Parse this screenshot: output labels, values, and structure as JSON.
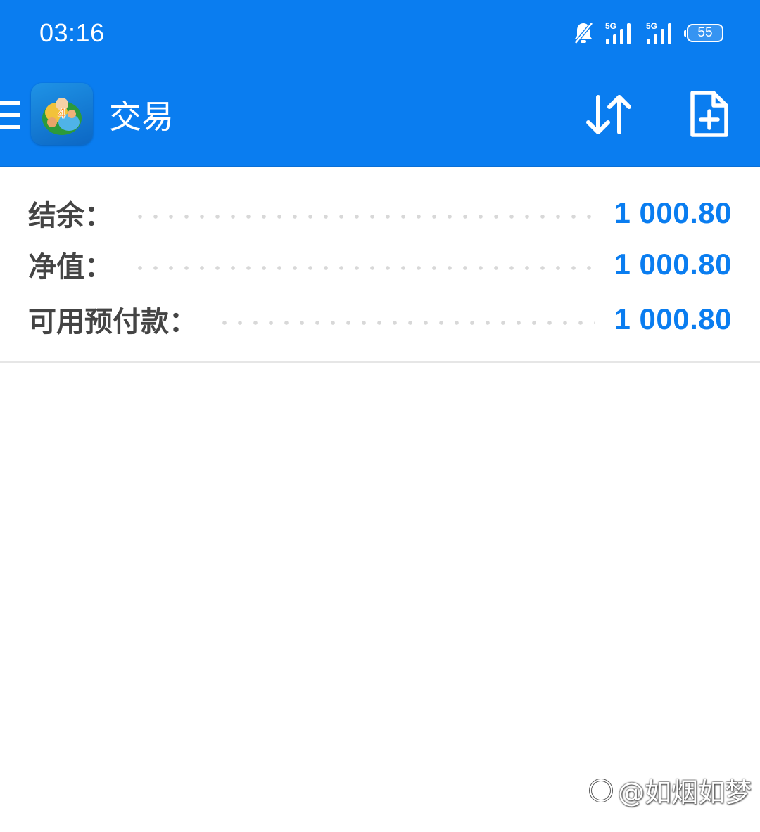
{
  "status_bar": {
    "time": "03:16",
    "network_1": "5G",
    "network_2": "5G",
    "battery": "55",
    "icons": [
      "bell-muted-icon",
      "signal-icon",
      "signal-icon",
      "battery-icon"
    ]
  },
  "header": {
    "title": "交易",
    "icons": [
      "menu-icon",
      "app-logo",
      "sort-icon",
      "new-order-icon"
    ]
  },
  "account": {
    "rows": [
      {
        "label": "结余：",
        "value": "1 000.80"
      },
      {
        "label": "净值：",
        "value": "1 000.80"
      },
      {
        "label": "可用预付款：",
        "value": "1 000.80"
      }
    ]
  },
  "watermark": {
    "text": "@如烟如梦"
  },
  "colors": {
    "accent": "#0a7df0",
    "label": "#444444",
    "background": "#ffffff"
  }
}
